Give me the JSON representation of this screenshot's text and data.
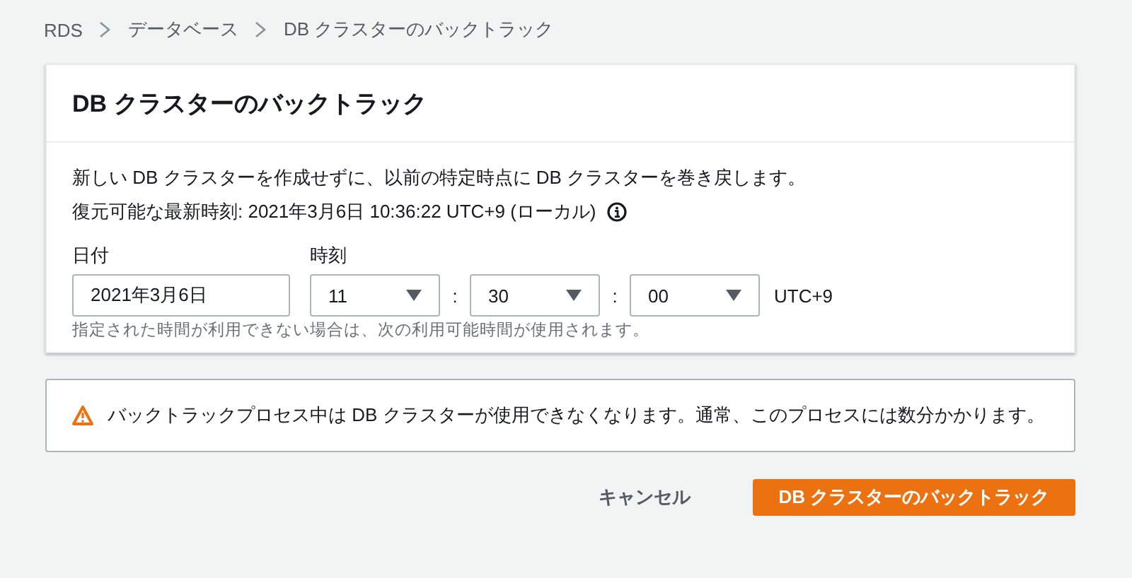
{
  "breadcrumbs": [
    "RDS",
    "データベース",
    "DB クラスターのバックトラック"
  ],
  "panel": {
    "title": "DB クラスターのバックトラック",
    "description": "新しい DB クラスターを作成せずに、以前の特定時点に DB クラスターを巻き戻します。",
    "latest_restorable_time": "復元可能な最新時刻: 2021年3月6日 10:36:22 UTC+9 (ローカル)",
    "date_label": "日付",
    "date_value": "2021年3月6日",
    "time_label": "時刻",
    "hour": "11",
    "minute": "30",
    "second": "00",
    "separator_1": ":",
    "separator_2": ":",
    "timezone": "UTC+9",
    "hint": "指定された時間が利用できない場合は、次の利用可能時間が使用されます。"
  },
  "warning": "バックトラックプロセス中は DB クラスターが使用できなくなります。通常、このプロセスには数分かかります。",
  "buttons": [
    {
      "kind": "link",
      "label": "キャンセル"
    },
    {
      "kind": "primary",
      "label": "DB クラスターのバックトラック"
    }
  ]
}
